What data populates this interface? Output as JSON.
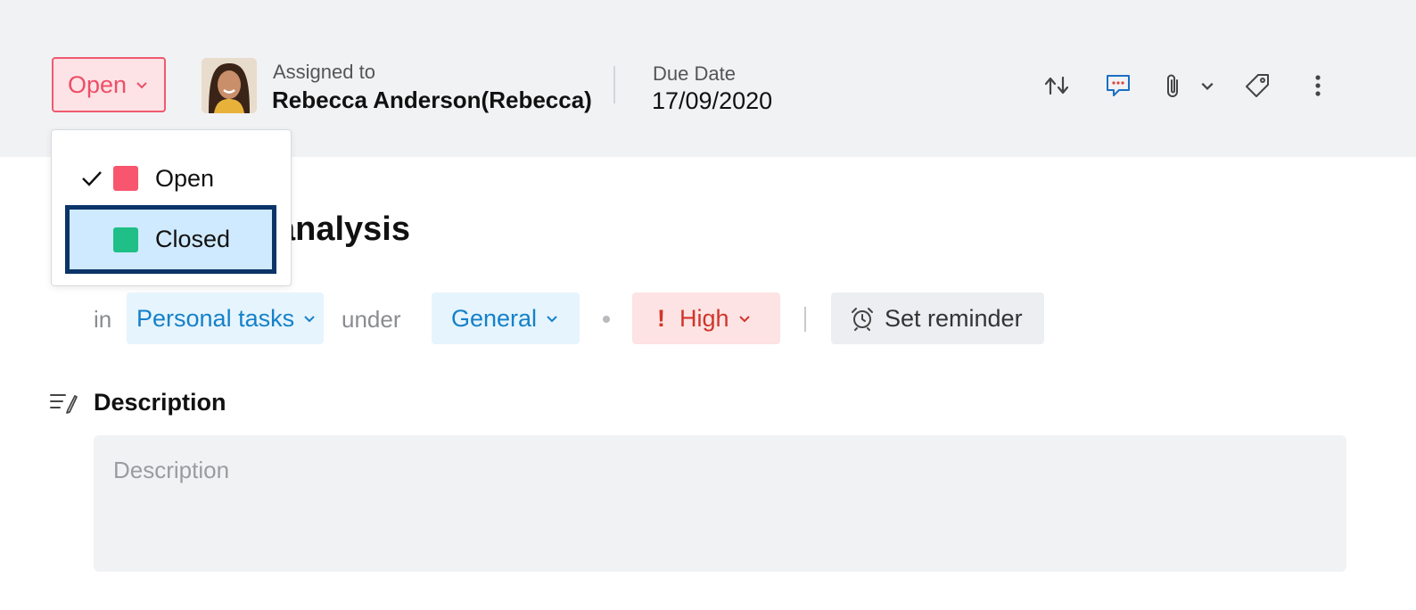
{
  "header": {
    "status": {
      "label": "Open",
      "color": "#ef4e66"
    },
    "assignee": {
      "label": "Assigned to",
      "name": "Rebecca Anderson(Rebecca)"
    },
    "due": {
      "label": "Due Date",
      "value": "17/09/2020"
    },
    "icons": [
      "repeat-icon",
      "comment-icon",
      "attachment-icon",
      "tag-icon",
      "more-vertical-icon"
    ]
  },
  "task": {
    "title_visible": "analysis",
    "meta": {
      "in_label": "in",
      "list": "Personal tasks",
      "under_label": "under",
      "category": "General",
      "priority": "High",
      "reminder": "Set reminder"
    }
  },
  "description": {
    "heading": "Description",
    "placeholder": "Description",
    "value": ""
  },
  "status_dropdown": {
    "options": [
      {
        "label": "Open",
        "color": "#f7566e",
        "checked": true
      },
      {
        "label": "Closed",
        "color": "#1fbf87",
        "highlighted": true
      }
    ]
  },
  "colors": {
    "header_bg": "#f1f2f4",
    "accent_blue": "#1481c9",
    "priority_red": "#d0352b",
    "focus_outline": "#0b3468"
  }
}
